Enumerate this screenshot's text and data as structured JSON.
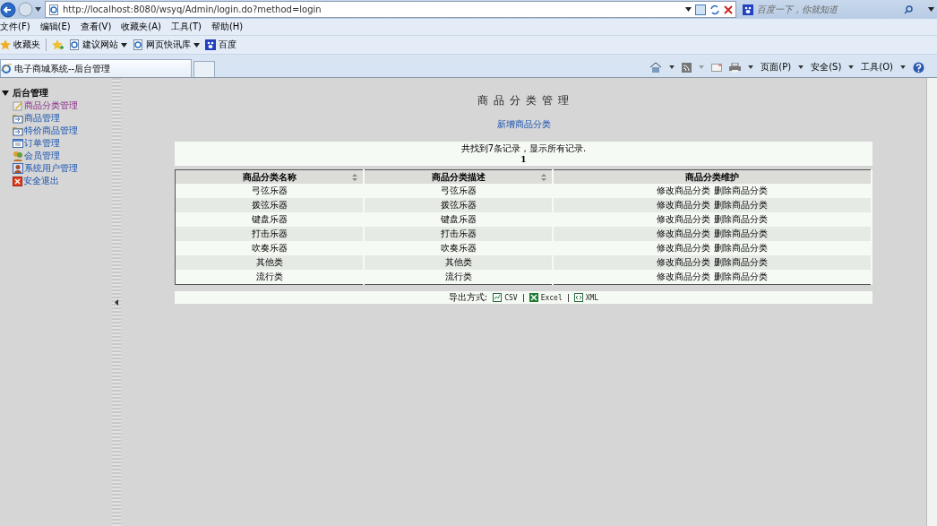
{
  "browser": {
    "url": "http://localhost:8080/wsyq/Admin/login.do?method=login",
    "search_placeholder": "百度一下，你就知道",
    "menu": [
      "文件(F)",
      "编辑(E)",
      "查看(V)",
      "收藏夹(A)",
      "工具(T)",
      "帮助(H)"
    ],
    "favorites": [
      {
        "label": "收藏夹",
        "kind": "star",
        "dropdown": false
      },
      {
        "label": "建议网站",
        "kind": "page",
        "dropdown": true
      },
      {
        "label": "网页快讯库",
        "kind": "page",
        "dropdown": true
      },
      {
        "label": "百度",
        "kind": "paw",
        "dropdown": false
      }
    ],
    "tab_title": "电子商城系统--后台管理",
    "commands": [
      "页面(P)",
      "安全(S)",
      "工具(O)"
    ]
  },
  "sidebar": {
    "heading": "后台管理",
    "expanded": true,
    "items": [
      {
        "label": "商品分类管理",
        "kind": "pencil",
        "selected": true
      },
      {
        "label": "商品管理",
        "kind": "folder",
        "selected": false
      },
      {
        "label": "特价商品管理",
        "kind": "folder",
        "selected": false
      },
      {
        "label": "订单管理",
        "kind": "list",
        "selected": false
      },
      {
        "label": "会员管理",
        "kind": "people",
        "selected": false
      },
      {
        "label": "系统用户管理",
        "kind": "user",
        "selected": false
      },
      {
        "label": "安全退出",
        "kind": "exit",
        "selected": false
      }
    ]
  },
  "main": {
    "title": "商 品 分 类 管 理",
    "add_link": "新增商品分类",
    "summary": "共找到7条记录，显示所有记录.",
    "page": "1",
    "columns": [
      {
        "label": "商品分类名称",
        "sortable": true
      },
      {
        "label": "商品分类描述",
        "sortable": true
      },
      {
        "label": "商品分类维护",
        "sortable": false
      }
    ],
    "rows": [
      {
        "name": "弓弦乐器",
        "description": "弓弦乐器",
        "edit": "修改商品分类",
        "delete": "删除商品分类"
      },
      {
        "name": "拨弦乐器",
        "description": "拨弦乐器",
        "edit": "修改商品分类",
        "delete": "删除商品分类"
      },
      {
        "name": "键盘乐器",
        "description": "键盘乐器",
        "edit": "修改商品分类",
        "delete": "删除商品分类"
      },
      {
        "name": "打击乐器",
        "description": "打击乐器",
        "edit": "修改商品分类",
        "delete": "删除商品分类"
      },
      {
        "name": "吹奏乐器",
        "description": "吹奏乐器",
        "edit": "修改商品分类",
        "delete": "删除商品分类"
      },
      {
        "name": "其他类",
        "description": "其他类",
        "edit": "修改商品分类",
        "delete": "删除商品分类"
      },
      {
        "name": "流行类",
        "description": "流行类",
        "edit": "修改商品分类",
        "delete": "删除商品分类"
      }
    ],
    "export_label": "导出方式:",
    "exports": [
      {
        "label": "CSV",
        "kind": "csv"
      },
      {
        "label": "Excel",
        "kind": "excel"
      },
      {
        "label": "XML",
        "kind": "xml"
      }
    ]
  }
}
